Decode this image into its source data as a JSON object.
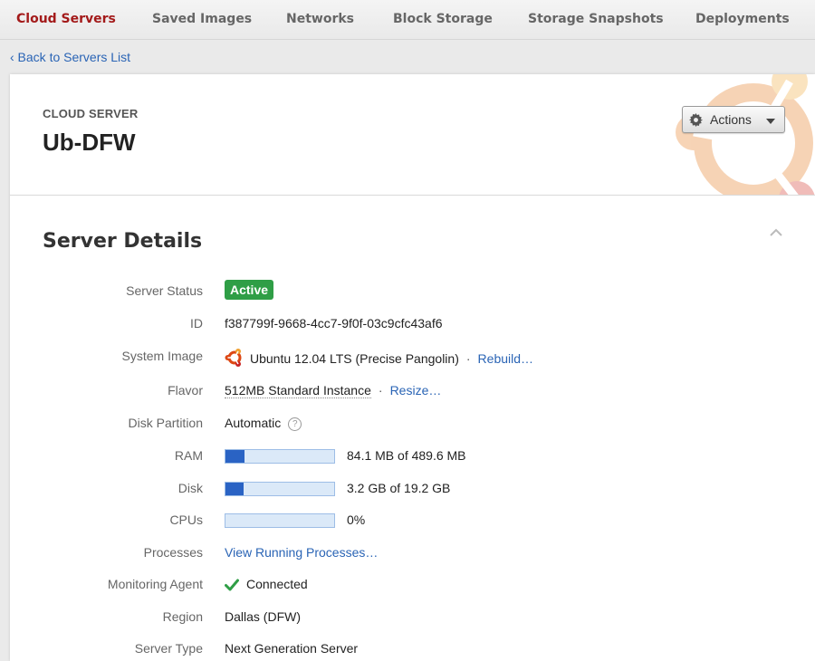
{
  "nav": {
    "tabs": [
      {
        "label": "Cloud Servers",
        "active": true
      },
      {
        "label": "Saved Images",
        "active": false
      },
      {
        "label": "Networks",
        "active": false
      },
      {
        "label": "Block Storage",
        "active": false
      },
      {
        "label": "Storage Snapshots",
        "active": false
      },
      {
        "label": "Deployments",
        "active": false
      }
    ],
    "back_link": "‹ Back to Servers List"
  },
  "header": {
    "eyebrow": "CLOUD SERVER",
    "server_name": "Ub-DFW",
    "actions_label": "Actions",
    "actions_icon": "gear-icon"
  },
  "details": {
    "title": "Server Details",
    "server_status": {
      "label": "Server Status",
      "value": "Active",
      "color": "#2f9e46"
    },
    "id": {
      "label": "ID",
      "value": "f387799f-9668-4cc7-9f0f-03c9cfc43af6"
    },
    "system_image": {
      "label": "System Image",
      "value": "Ubuntu 12.04 LTS (Precise Pangolin)",
      "icon": "ubuntu-logo-icon",
      "sep": "·",
      "action": "Rebuild…"
    },
    "flavor": {
      "label": "Flavor",
      "value": "512MB Standard Instance",
      "sep": "·",
      "action": "Resize…"
    },
    "disk_partition": {
      "label": "Disk Partition",
      "value": "Automatic",
      "help": "?"
    },
    "ram": {
      "label": "RAM",
      "text": "84.1 MB of 489.6 MB",
      "fraction": 0.172
    },
    "disk": {
      "label": "Disk",
      "text": "3.2 GB of 19.2 GB",
      "fraction": 0.167
    },
    "cpus": {
      "label": "CPUs",
      "text": "0%",
      "fraction": 0
    },
    "processes": {
      "label": "Processes",
      "action": "View Running Processes…"
    },
    "monitoring": {
      "label": "Monitoring Agent",
      "value": "Connected",
      "icon": "checkmark-icon",
      "color": "#2f9e46"
    },
    "region": {
      "label": "Region",
      "value": "Dallas (DFW)"
    },
    "server_type": {
      "label": "Server Type",
      "value": "Next Generation Server"
    }
  },
  "colors": {
    "active_tab": "#a31a1a",
    "link": "#2a64b5",
    "bar_fill": "#2a63c4",
    "bar_track": "#dbe9f8",
    "ubuntu_orange": "#dd4814"
  }
}
